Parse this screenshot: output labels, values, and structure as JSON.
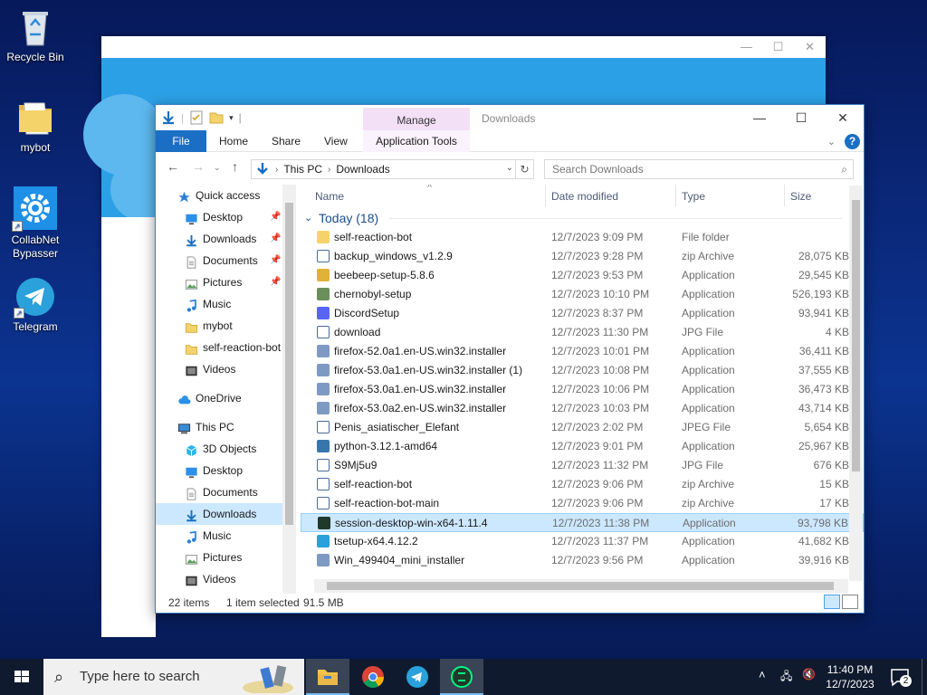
{
  "desktop": {
    "icons": [
      {
        "label": "Recycle Bin"
      },
      {
        "label": "mybot"
      },
      {
        "label": "CollabNet Bypasser"
      },
      {
        "label": "Telegram"
      }
    ]
  },
  "explorer": {
    "title": "Downloads",
    "manage_tab": "Manage",
    "ribbon": {
      "file": "File",
      "home": "Home",
      "share": "Share",
      "view": "View",
      "app_tools": "Application Tools",
      "help": "?"
    },
    "address": {
      "parts": [
        "This PC",
        "Downloads"
      ]
    },
    "search_placeholder": "Search Downloads",
    "nav": [
      {
        "label": "Quick access",
        "icon": "star-icon",
        "pinned": false,
        "selected": false,
        "top": true
      },
      {
        "label": "Desktop",
        "icon": "desktop-icon",
        "pinned": true,
        "selected": false
      },
      {
        "label": "Downloads",
        "icon": "download-arrow-icon",
        "pinned": true,
        "selected": false
      },
      {
        "label": "Documents",
        "icon": "document-icon",
        "pinned": true,
        "selected": false
      },
      {
        "label": "Pictures",
        "icon": "pictures-icon",
        "pinned": true,
        "selected": false
      },
      {
        "label": "Music",
        "icon": "music-icon",
        "pinned": false,
        "selected": false
      },
      {
        "label": "mybot",
        "icon": "folder-icon",
        "pinned": false,
        "selected": false
      },
      {
        "label": "self-reaction-bot",
        "icon": "folder-icon",
        "pinned": false,
        "selected": false
      },
      {
        "label": "Videos",
        "icon": "videos-icon",
        "pinned": false,
        "selected": false
      },
      {
        "label": "OneDrive",
        "icon": "cloud-icon",
        "pinned": false,
        "selected": false,
        "top": true,
        "gap": true
      },
      {
        "label": "This PC",
        "icon": "computer-icon",
        "pinned": false,
        "selected": false,
        "top": true,
        "gap": true
      },
      {
        "label": "3D Objects",
        "icon": "cube-icon",
        "pinned": false,
        "selected": false
      },
      {
        "label": "Desktop",
        "icon": "desktop-icon",
        "pinned": false,
        "selected": false
      },
      {
        "label": "Documents",
        "icon": "document-icon",
        "pinned": false,
        "selected": false
      },
      {
        "label": "Downloads",
        "icon": "download-arrow-icon",
        "pinned": false,
        "selected": true
      },
      {
        "label": "Music",
        "icon": "music-icon",
        "pinned": false,
        "selected": false
      },
      {
        "label": "Pictures",
        "icon": "pictures-icon",
        "pinned": false,
        "selected": false
      },
      {
        "label": "Videos",
        "icon": "videos-icon",
        "pinned": false,
        "selected": false
      }
    ],
    "columns": {
      "name": "Name",
      "date": "Date modified",
      "type": "Type",
      "size": "Size"
    },
    "group_label": "Today (18)",
    "files": [
      {
        "name": "self-reaction-bot",
        "date": "12/7/2023 9:09 PM",
        "type": "File folder",
        "size": "",
        "icon": "folder-icon",
        "color": "#f5d36b",
        "selected": false
      },
      {
        "name": "backup_windows_v1.2.9",
        "date": "12/7/2023 9:28 PM",
        "type": "zip Archive",
        "size": "28,075 KB",
        "icon": "zip-icon",
        "color": "#2d4e8a",
        "selected": false
      },
      {
        "name": "beebeep-setup-5.8.6",
        "date": "12/7/2023 9:53 PM",
        "type": "Application",
        "size": "29,545 KB",
        "icon": "beebeep-icon",
        "color": "#e0b23a",
        "selected": false
      },
      {
        "name": "chernobyl-setup",
        "date": "12/7/2023 10:10 PM",
        "type": "Application",
        "size": "526,193 KB",
        "icon": "installer-icon",
        "color": "#6a8f5a",
        "selected": false
      },
      {
        "name": "DiscordSetup",
        "date": "12/7/2023 8:37 PM",
        "type": "Application",
        "size": "93,941 KB",
        "icon": "discord-icon",
        "color": "#5865f2",
        "selected": false
      },
      {
        "name": "download",
        "date": "12/7/2023 11:30 PM",
        "type": "JPG File",
        "size": "4 KB",
        "icon": "image-file-icon",
        "color": "#3b6fb6",
        "selected": false
      },
      {
        "name": "firefox-52.0a1.en-US.win32.installer",
        "date": "12/7/2023 10:01 PM",
        "type": "Application",
        "size": "36,411 KB",
        "icon": "installer-icon",
        "color": "#7f9ac2",
        "selected": false
      },
      {
        "name": "firefox-53.0a1.en-US.win32.installer (1)",
        "date": "12/7/2023 10:08 PM",
        "type": "Application",
        "size": "37,555 KB",
        "icon": "installer-icon",
        "color": "#7f9ac2",
        "selected": false
      },
      {
        "name": "firefox-53.0a1.en-US.win32.installer",
        "date": "12/7/2023 10:06 PM",
        "type": "Application",
        "size": "36,473 KB",
        "icon": "installer-icon",
        "color": "#7f9ac2",
        "selected": false
      },
      {
        "name": "firefox-53.0a2.en-US.win32.installer",
        "date": "12/7/2023 10:03 PM",
        "type": "Application",
        "size": "43,714 KB",
        "icon": "installer-icon",
        "color": "#7f9ac2",
        "selected": false
      },
      {
        "name": "Penis_asiatischer_Elefant",
        "date": "12/7/2023 2:02 PM",
        "type": "JPEG File",
        "size": "5,654 KB",
        "icon": "image-file-icon",
        "color": "#ffffff",
        "selected": false
      },
      {
        "name": "python-3.12.1-amd64",
        "date": "12/7/2023 9:01 PM",
        "type": "Application",
        "size": "25,967 KB",
        "icon": "python-icon",
        "color": "#3776ab",
        "selected": false
      },
      {
        "name": "S9Mj5u9",
        "date": "12/7/2023 11:32 PM",
        "type": "JPG File",
        "size": "676 KB",
        "icon": "image-file-icon",
        "color": "#3b6fb6",
        "selected": false
      },
      {
        "name": "self-reaction-bot",
        "date": "12/7/2023 9:06 PM",
        "type": "zip Archive",
        "size": "15 KB",
        "icon": "zip-icon",
        "color": "#2d4e8a",
        "selected": false
      },
      {
        "name": "self-reaction-bot-main",
        "date": "12/7/2023 9:06 PM",
        "type": "zip Archive",
        "size": "17 KB",
        "icon": "zip-icon",
        "color": "#2d4e8a",
        "selected": false
      },
      {
        "name": "session-desktop-win-x64-1.11.4",
        "date": "12/7/2023 11:38 PM",
        "type": "Application",
        "size": "93,798 KB",
        "icon": "session-icon",
        "color": "#1f3a2a",
        "selected": true
      },
      {
        "name": "tsetup-x64.4.12.2",
        "date": "12/7/2023 11:37 PM",
        "type": "Application",
        "size": "41,682 KB",
        "icon": "telegram-icon",
        "color": "#2aa1da",
        "selected": false
      },
      {
        "name": "Win_499404_mini_installer",
        "date": "12/7/2023 9:56 PM",
        "type": "Application",
        "size": "39,916 KB",
        "icon": "installer-icon",
        "color": "#7f9ac2",
        "selected": false
      }
    ],
    "status": {
      "items": "22 items",
      "selected": "1 item selected",
      "size": "91.5 MB"
    }
  },
  "taskbar": {
    "search_placeholder": "Type here to search",
    "clock_time": "11:40 PM",
    "clock_date": "12/7/2023",
    "notification_count": "2",
    "apps": [
      {
        "name": "file-explorer",
        "icon": "file-explorer-icon",
        "active": true
      },
      {
        "name": "chrome",
        "icon": "chrome-icon",
        "active": false
      },
      {
        "name": "telegram",
        "icon": "telegram-icon",
        "active": false
      },
      {
        "name": "session",
        "icon": "session-icon",
        "active": true
      }
    ]
  },
  "colors": {
    "accent": "#1a6fc4",
    "selection": "#cce8ff",
    "manage_tab": "#f3e0f7",
    "taskbar": "#0f1a2e"
  }
}
